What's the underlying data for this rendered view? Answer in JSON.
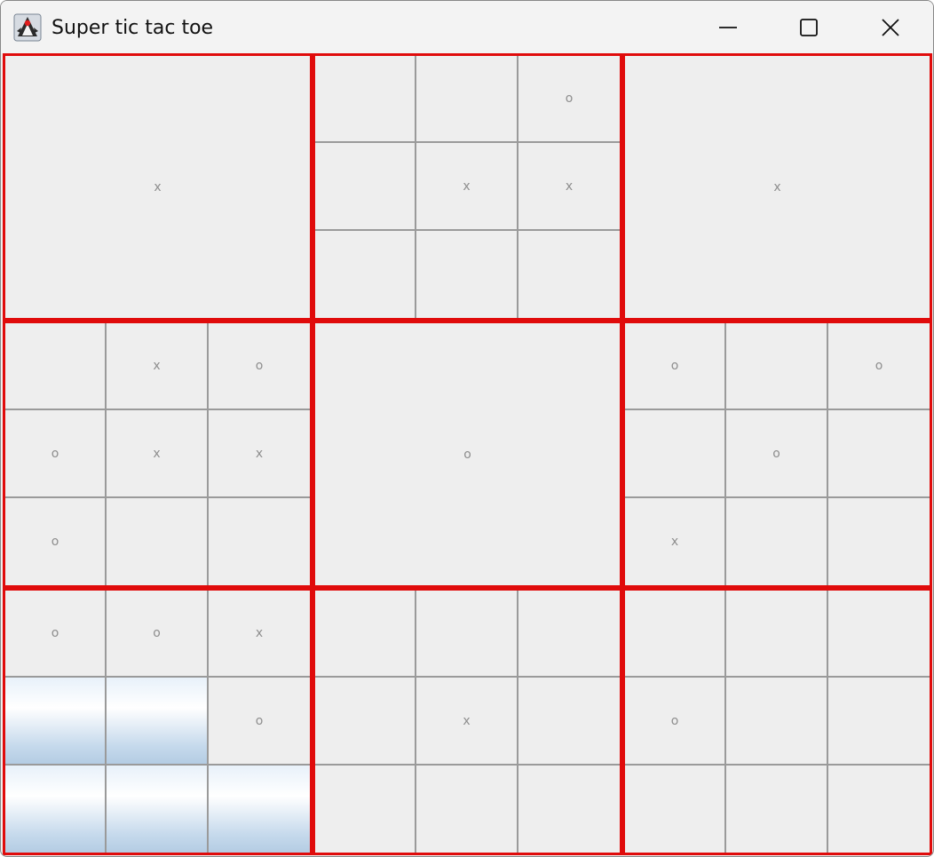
{
  "window": {
    "title": "Super tic tac toe",
    "icons": {
      "app": "java-duke-icon",
      "minimize": "minimize-icon",
      "maximize": "maximize-icon",
      "close": "close-icon"
    }
  },
  "colors": {
    "board_border": "#e00b0b",
    "cell_border": "#9a9a9a",
    "mark": "#8e8e8e",
    "background": "#eeeeee",
    "highlight_top": "#ffffff",
    "highlight_bottom": "#b4cce3"
  },
  "boards": [
    {
      "winner": "x",
      "cells": [
        "",
        "",
        "",
        "",
        "",
        "",
        "",
        "",
        ""
      ],
      "highlight": []
    },
    {
      "winner": "",
      "cells": [
        "",
        "",
        "o",
        "",
        "x",
        "x",
        "",
        "",
        ""
      ],
      "highlight": []
    },
    {
      "winner": "x",
      "cells": [
        "",
        "",
        "",
        "",
        "",
        "",
        "",
        "",
        ""
      ],
      "highlight": []
    },
    {
      "winner": "",
      "cells": [
        "",
        "x",
        "o",
        "o",
        "x",
        "x",
        "o",
        "",
        ""
      ],
      "highlight": []
    },
    {
      "winner": "o",
      "cells": [
        "",
        "",
        "",
        "",
        "",
        "",
        "",
        "",
        ""
      ],
      "highlight": []
    },
    {
      "winner": "",
      "cells": [
        "o",
        "",
        "o",
        "",
        "o",
        "",
        "x",
        "",
        ""
      ],
      "highlight": []
    },
    {
      "winner": "",
      "cells": [
        "o",
        "o",
        "x",
        "",
        "",
        "o",
        "",
        "",
        ""
      ],
      "highlight": [
        3,
        4,
        6,
        7,
        8
      ]
    },
    {
      "winner": "",
      "cells": [
        "",
        "",
        "",
        "",
        "x",
        "",
        "",
        "",
        ""
      ],
      "highlight": []
    },
    {
      "winner": "",
      "cells": [
        "",
        "",
        "",
        "o",
        "",
        "",
        "",
        "",
        ""
      ],
      "highlight": []
    }
  ]
}
